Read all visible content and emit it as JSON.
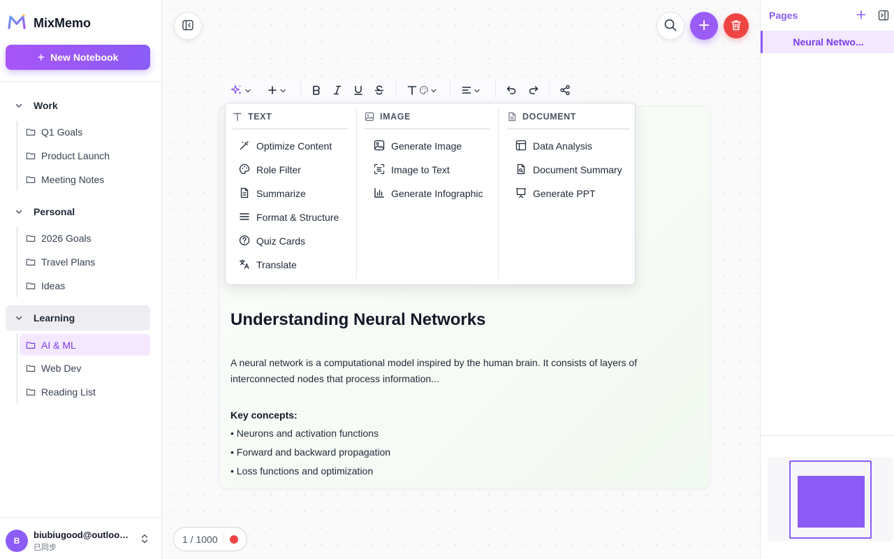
{
  "app": {
    "name": "MixMemo"
  },
  "sidebar": {
    "new_notebook_label": "New Notebook",
    "groups": [
      {
        "label": "Work",
        "items": [
          "Q1 Goals",
          "Product Launch",
          "Meeting Notes"
        ]
      },
      {
        "label": "Personal",
        "items": [
          "2026 Goals",
          "Travel Plans",
          "Ideas"
        ]
      },
      {
        "label": "Learning",
        "items": [
          "AI & ML",
          "Web Dev",
          "Reading List"
        ]
      }
    ],
    "active_group": "Learning",
    "active_item": "AI & ML",
    "user": {
      "avatar_letter": "B",
      "email": "biubiugood@outlook.com",
      "status": "已同步"
    }
  },
  "ai_menu": {
    "columns": [
      {
        "header": "TEXT",
        "items": [
          "Optimize Content",
          "Role Filter",
          "Summarize",
          "Format & Structure",
          "Quiz Cards",
          "Translate"
        ]
      },
      {
        "header": "IMAGE",
        "items": [
          "Generate Image",
          "Image to Text",
          "Generate Infographic"
        ]
      },
      {
        "header": "DOCUMENT",
        "items": [
          "Data Analysis",
          "Document Summary",
          "Generate PPT"
        ]
      }
    ]
  },
  "note": {
    "title": "Understanding Neural Networks",
    "paragraph": "A neural network is a computational model inspired by the human brain. It consists of layers of interconnected nodes that process information...",
    "key_heading": "Key concepts:",
    "bullets": [
      "• Neurons and activation functions",
      "• Forward and backward propagation",
      "• Loss functions and optimization"
    ]
  },
  "counter": {
    "text": "1 / 1000"
  },
  "pages_panel": {
    "title": "Pages",
    "items": [
      "Neural Netwo..."
    ]
  },
  "colors": {
    "accent": "#8b5cf6",
    "danger": "#ef4444",
    "active_bg": "#f3e8ff"
  }
}
